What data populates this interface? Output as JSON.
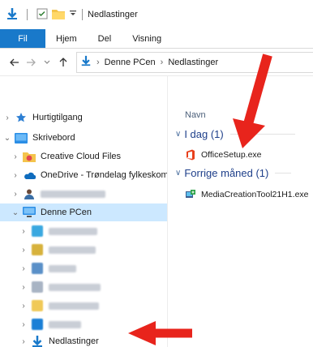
{
  "window": {
    "title": "Nedlastinger"
  },
  "ribbon": {
    "tabs": [
      "Fil",
      "Hjem",
      "Del",
      "Visning"
    ]
  },
  "address": {
    "crumbs": [
      "Denne PCen",
      "Nedlastinger"
    ]
  },
  "nav": {
    "items": [
      {
        "label": "Hurtigtilgang",
        "icon": "star-icon"
      },
      {
        "label": "Skrivebord",
        "icon": "desktop-folder-icon"
      },
      {
        "label": "Creative Cloud Files",
        "icon": "creative-cloud-icon"
      },
      {
        "label": "OneDrive - Trøndelag fylkeskomm",
        "icon": "onedrive-icon"
      },
      {
        "label": "Denne PCen",
        "icon": "this-pc-icon"
      },
      {
        "label": "Nedlastinger",
        "icon": "downloads-icon"
      }
    ]
  },
  "content": {
    "column_header": "Navn",
    "groups": [
      {
        "label": "I dag (1)",
        "files": [
          {
            "name": "OfficeSetup.exe",
            "icon": "office-icon"
          }
        ]
      },
      {
        "label": "Forrige måned (1)",
        "files": [
          {
            "name": "MediaCreationTool21H1.exe",
            "icon": "media-creation-tool-icon"
          }
        ]
      }
    ]
  },
  "colors": {
    "file_tab": "#1979ca",
    "selection": "#cce8ff",
    "arrow": "#e8241c",
    "group_text": "#1e3f8a"
  }
}
